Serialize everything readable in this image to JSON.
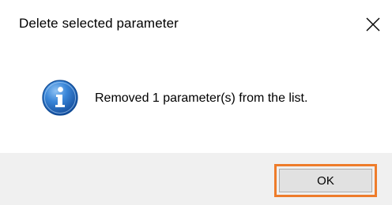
{
  "dialog": {
    "title": "Delete selected parameter",
    "close_icon": "close-icon",
    "info_icon": "info-icon",
    "message": "Removed 1 parameter(s) from the list.",
    "ok_label": "OK",
    "highlight_color": "#ee7c2b"
  }
}
